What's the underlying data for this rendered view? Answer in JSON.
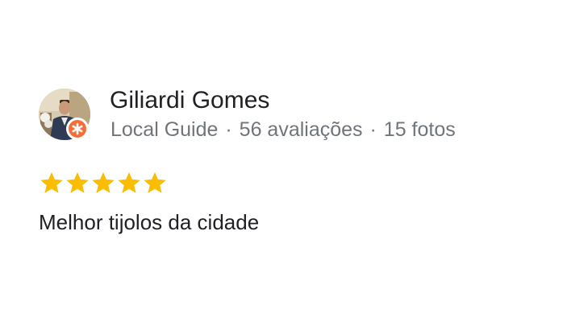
{
  "review": {
    "author": {
      "name": "Giliardi Gomes",
      "badge_icon": "local-guide-star-icon",
      "badge_color": "#f26f3b",
      "level": "Local Guide",
      "separator": "·",
      "reviews_count": "56 avaliações",
      "photos_count": "15 fotos"
    },
    "rating": {
      "value": 5,
      "max": 5,
      "star_icon": "star-icon",
      "star_color": "#fbbc04"
    },
    "text": "Melhor tijolos da cidade"
  }
}
